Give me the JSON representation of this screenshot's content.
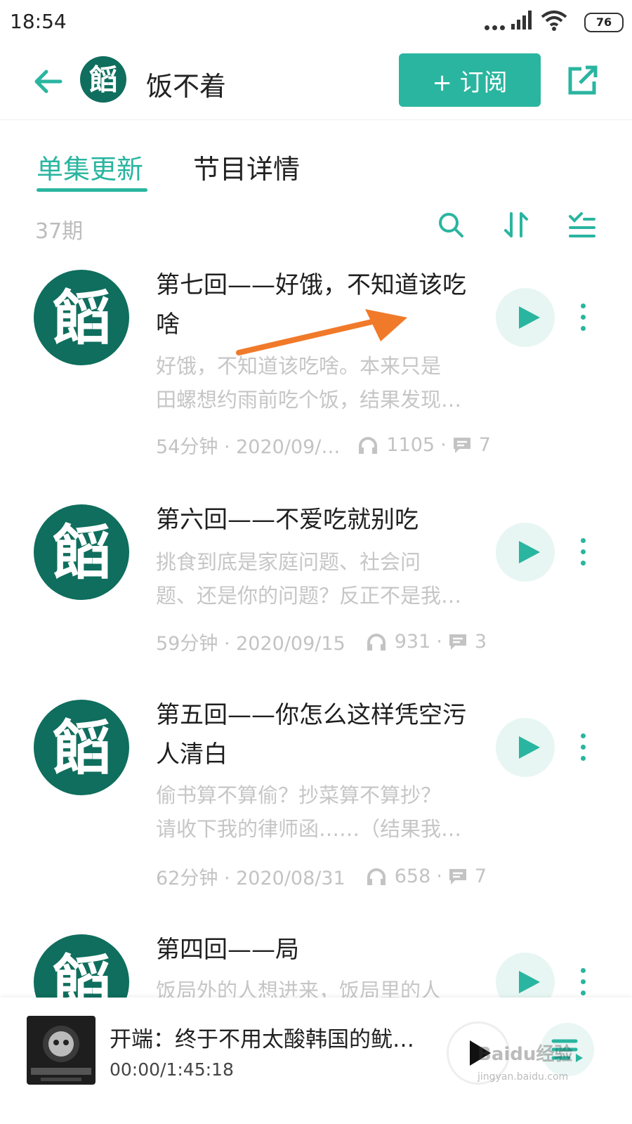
{
  "status": {
    "time": "18:54",
    "battery": "76"
  },
  "header": {
    "title": "饭不着",
    "subscribe_label": "+ 订阅"
  },
  "tabs": [
    {
      "label": "单集更新",
      "active": true
    },
    {
      "label": "节目详情",
      "active": false
    }
  ],
  "episode_count": "37期",
  "episodes": [
    {
      "title": "第七回——好饿，不知道该吃啥",
      "desc_lines": [
        "好饿，不知道该吃啥。本来只是",
        "田螺想约雨前吃个饭，结果发现…"
      ],
      "duration_date": "54分钟 · 2020/09/…",
      "plays": "1105",
      "comments": "7"
    },
    {
      "title": "第六回——不爱吃就别吃",
      "desc_lines": [
        "挑食到底是家庭问题、社会问",
        "题、还是你的问题？反正不是我…"
      ],
      "duration_date": "59分钟 · 2020/09/15",
      "plays": "931",
      "comments": "3"
    },
    {
      "title": "第五回——你怎么这样凭空污人清白",
      "desc_lines": [
        "偷书算不算偷？抄菜算不算抄？",
        "请收下我的律师函……（结果我…"
      ],
      "duration_date": "62分钟 · 2020/08/31",
      "plays": "658",
      "comments": "7"
    },
    {
      "title": "第四回——局",
      "desc_lines": [
        "饭局外的人想进来，饭局里的人"
      ],
      "duration_date": "",
      "plays": "",
      "comments": ""
    }
  ],
  "player": {
    "title": "开端：终于不用太酸韩国的鱿…",
    "time": "00:00/1:45:18"
  },
  "watermark": {
    "main": "Baidu经验",
    "sub": "jingyan.baidu.com"
  },
  "colors": {
    "accent": "#2ab5a0",
    "logo_bg": "#0f6e5d",
    "annotation_arrow": "#f07a2a"
  }
}
